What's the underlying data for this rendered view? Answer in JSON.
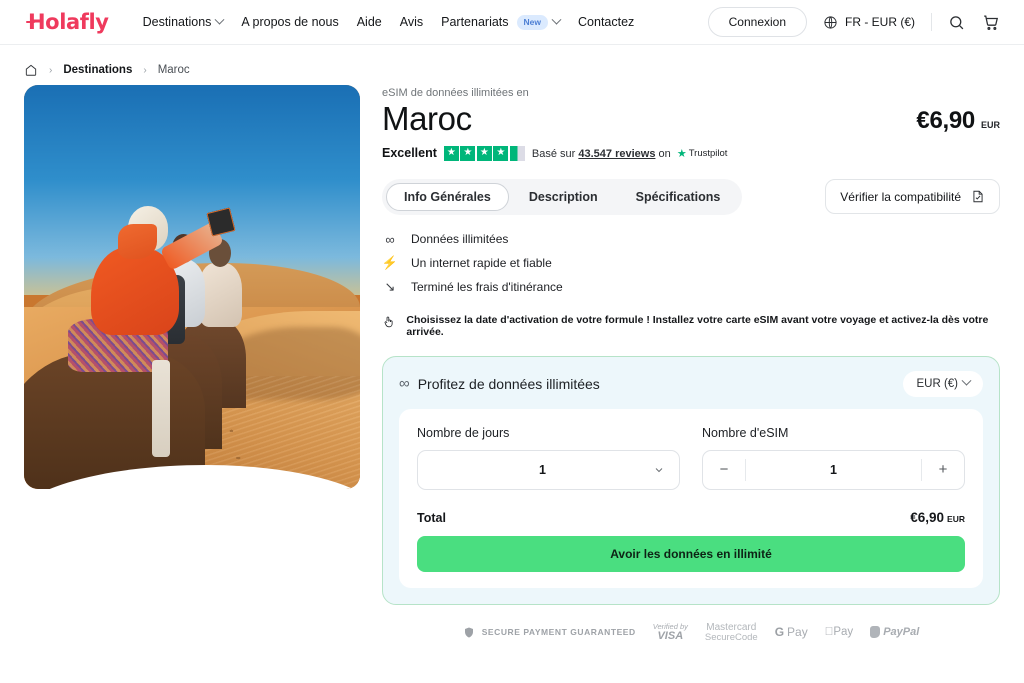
{
  "nav": {
    "logo": "Holafly",
    "links": [
      {
        "label": "Destinations",
        "caret": true,
        "badge": null
      },
      {
        "label": "A propos de nous",
        "caret": false,
        "badge": null
      },
      {
        "label": "Aide",
        "caret": false,
        "badge": null
      },
      {
        "label": "Avis",
        "caret": false,
        "badge": null
      },
      {
        "label": "Partenariats",
        "caret": true,
        "badge": "New"
      },
      {
        "label": "Contactez",
        "caret": false,
        "badge": null
      }
    ],
    "login_label": "Connexion",
    "locale_label": "FR - EUR (€)",
    "globe_icon": "globe-icon",
    "search_icon": "search-icon",
    "cart_icon": "cart-icon",
    "cart_count": "0"
  },
  "breadcrumb": {
    "home_icon": "home-icon",
    "separator": "›",
    "parent": "Destinations",
    "current": "Maroc"
  },
  "product": {
    "eyebrow": "eSIM de données illimitées en",
    "title": "Maroc",
    "price": "€6,90",
    "price_currency": "EUR"
  },
  "trustpilot": {
    "rating_word": "Excellent",
    "stars_filled": 4,
    "stars_half": 1,
    "prefix": "Basé sur",
    "reviews_count": "43.547 reviews",
    "on_label": "on",
    "brand": "Trustpilot",
    "star_color": "#00b67a"
  },
  "tabs": [
    {
      "label": "Info Générales",
      "active": true
    },
    {
      "label": "Description",
      "active": false
    },
    {
      "label": "Spécifications",
      "active": false
    }
  ],
  "compat_button": {
    "label": "Vérifier la compatibilité",
    "icon": "device-check-icon"
  },
  "features": [
    {
      "icon": "infinity-icon",
      "glyph": "∞",
      "label": "Données illimitées"
    },
    {
      "icon": "lightning-icon",
      "glyph": "⚡",
      "label": "Un internet rapide et fiable"
    },
    {
      "icon": "no-roaming-icon",
      "glyph": "↘",
      "label": "Terminé les frais d'itinérance"
    }
  ],
  "notice": {
    "icon": "tap-hand-icon",
    "text": "Choisissez la date d'activation de votre formule ! Installez votre carte eSIM avant votre voyage et activez-la dès votre arrivée."
  },
  "purchase_card": {
    "title": "Profitez de données illimitées",
    "title_icon": "infinity-icon",
    "currency_selector": "EUR (€)",
    "border_color": "#b6e3c8",
    "background_color": "#edf7fb",
    "days": {
      "label": "Nombre de jours",
      "value": "1",
      "icon": "chevron-down-icon"
    },
    "esim": {
      "label": "Nombre d'eSIM",
      "value": "1",
      "minus": "−",
      "plus": "+"
    },
    "total": {
      "label": "Total",
      "value": "€6,90",
      "currency": "EUR"
    },
    "cta": {
      "label": "Avoir les données en illimité",
      "color": "#4ade80"
    }
  },
  "payments": {
    "secure_icon": "shield-check-icon",
    "secure_label": "SECURE PAYMENT GUARANTEED",
    "visa_top": "Verified by",
    "visa_name": "VISA",
    "mastercard_top": "Mastercard",
    "mastercard_bottom": "SecureCode",
    "gpay_g": "G",
    "gpay_label": "Pay",
    "applepay_label": "Pay",
    "paypal_label": "PayPal"
  },
  "hero": {
    "alt": "Touristes à dos de chameau dans le désert du Sahara au Maroc"
  }
}
